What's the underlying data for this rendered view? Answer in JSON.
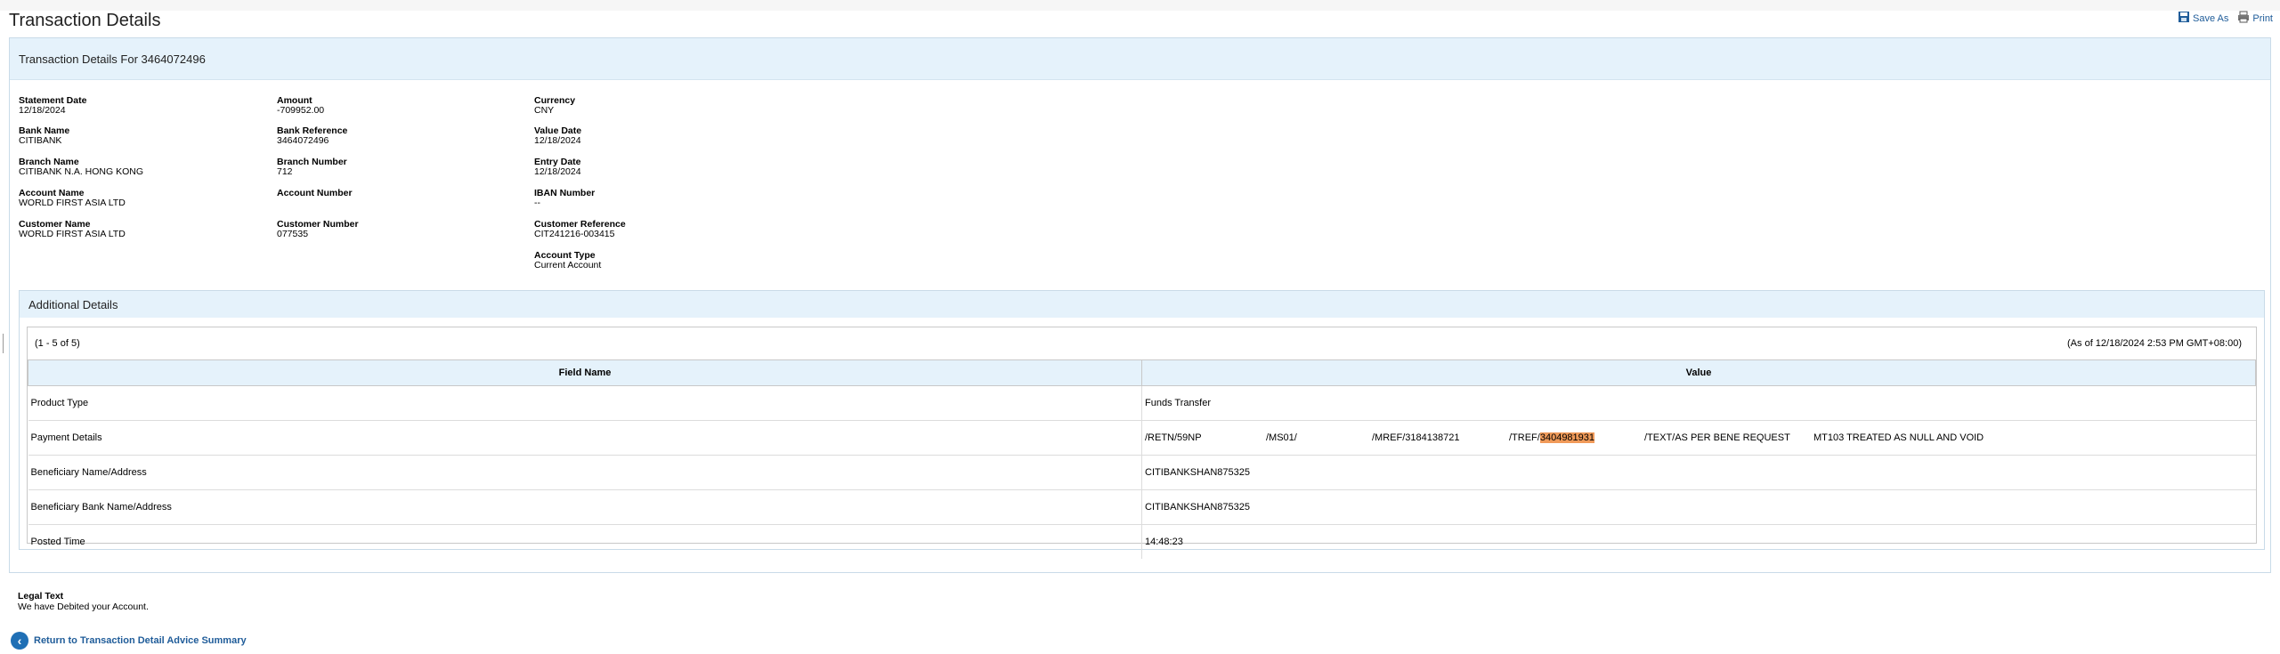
{
  "page_title": "Transaction Details",
  "actions": {
    "save_as": "Save As",
    "print": "Print"
  },
  "panel_title": "Transaction Details For 3464072496",
  "fields": {
    "statement_date": {
      "label": "Statement Date",
      "value": "12/18/2024"
    },
    "amount": {
      "label": "Amount",
      "value": "-709952.00"
    },
    "currency": {
      "label": "Currency",
      "value": "CNY"
    },
    "bank_name": {
      "label": "Bank Name",
      "value": "CITIBANK"
    },
    "bank_reference": {
      "label": "Bank Reference",
      "value": "3464072496"
    },
    "value_date": {
      "label": "Value Date",
      "value": "12/18/2024"
    },
    "branch_name": {
      "label": "Branch Name",
      "value": "CITIBANK N.A. HONG KONG"
    },
    "branch_number": {
      "label": "Branch Number",
      "value": "712"
    },
    "entry_date": {
      "label": "Entry Date",
      "value": "12/18/2024"
    },
    "account_name": {
      "label": "Account Name",
      "value": "WORLD FIRST ASIA LTD"
    },
    "account_number": {
      "label": "Account Number",
      "value": ""
    },
    "iban_number": {
      "label": "IBAN Number",
      "value": "--"
    },
    "customer_name": {
      "label": "Customer Name",
      "value": "WORLD FIRST ASIA LTD"
    },
    "customer_number": {
      "label": "Customer Number",
      "value": "077535"
    },
    "customer_reference": {
      "label": "Customer Reference",
      "value": "CIT241216-003415"
    },
    "account_type": {
      "label": "Account Type",
      "value": "Current Account"
    }
  },
  "additional": {
    "title": "Additional Details",
    "range": "(1 - 5 of 5)",
    "as_of": "(As of 12/18/2024 2:53 PM GMT+08:00)",
    "columns": [
      "Field Name",
      "Value"
    ],
    "rows": [
      {
        "name": "Product Type",
        "value": "Funds Transfer"
      },
      {
        "name": "Payment Details",
        "value": ""
      },
      {
        "name": "Beneficiary Name/Address",
        "value": "CITIBANKSHAN875325"
      },
      {
        "name": "Beneficiary Bank Name/Address",
        "value": "CITIBANKSHAN875325"
      },
      {
        "name": "Posted Time",
        "value": "14:48:23"
      }
    ],
    "payment_details": {
      "retn": "/RETN/59NP",
      "ms": "/MS01/",
      "mref": "/MREF/3184138721",
      "tref_prefix": "/TREF/",
      "tref_highlight": "3404981931",
      "text": "/TEXT/AS PER BENE REQUEST",
      "mt": "MT103 TREATED AS NULL AND VOID"
    }
  },
  "legal": {
    "label": "Legal Text",
    "text": "We have Debited your Account."
  },
  "return_link": "Return to Transaction Detail Advice Summary",
  "colors": {
    "accent": "#1f5c99",
    "header_bg": "#e5f2fb",
    "highlight": "#f09a59"
  }
}
